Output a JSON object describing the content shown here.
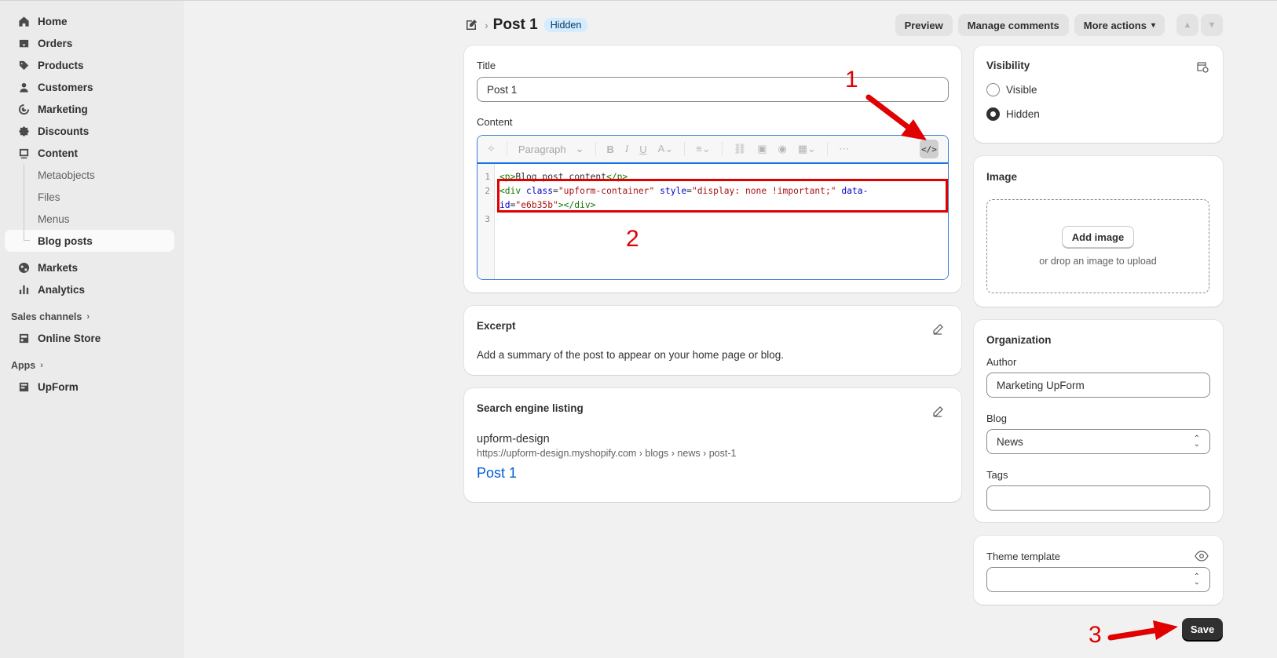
{
  "sidebar": {
    "items": [
      {
        "label": "Home",
        "icon": "home-icon"
      },
      {
        "label": "Orders",
        "icon": "orders-icon"
      },
      {
        "label": "Products",
        "icon": "tag-icon"
      },
      {
        "label": "Customers",
        "icon": "person-icon"
      },
      {
        "label": "Marketing",
        "icon": "target-icon"
      },
      {
        "label": "Discounts",
        "icon": "discount-icon"
      },
      {
        "label": "Content",
        "icon": "content-icon"
      }
    ],
    "content_subitems": [
      "Metaobjects",
      "Files",
      "Menus",
      "Blog posts"
    ],
    "active_subitem": "Blog posts",
    "items2": [
      {
        "label": "Markets",
        "icon": "globe-icon"
      },
      {
        "label": "Analytics",
        "icon": "bar-chart-icon"
      }
    ],
    "sales_channels_label": "Sales channels",
    "online_store_label": "Online Store",
    "apps_label": "Apps",
    "upform_label": "UpForm"
  },
  "header": {
    "title": "Post 1",
    "status_badge": "Hidden",
    "preview": "Preview",
    "manage_comments": "Manage comments",
    "more_actions": "More actions"
  },
  "main": {
    "title_label": "Title",
    "title_value": "Post 1",
    "content_label": "Content",
    "paragraph_select": "Paragraph",
    "code_lines": [
      "1",
      "2",
      "3"
    ],
    "code": {
      "line1_open": "<p>",
      "line1_text": "Blog post content",
      "line1_close": "</p>",
      "line2_tag_open": "<div",
      "line2_attr1": "class",
      "line2_val1": "\"upform-container\"",
      "line2_attr2": "style",
      "line2_val2": "\"display: none !important;\"",
      "line2_attr3a": "data-",
      "line2_attr3b": "id",
      "line2_val3": "\"e6b35b\"",
      "line2_tag_close": "></div>",
      "eq": "="
    },
    "excerpt_title": "Excerpt",
    "excerpt_text": "Add a summary of the post to appear on your home page or blog.",
    "seo_title": "Search engine listing",
    "seo_site": "upform-design",
    "seo_url": "https://upform-design.myshopify.com › blogs › news › post-1",
    "seo_link": "Post 1"
  },
  "right": {
    "visibility_title": "Visibility",
    "visible": "Visible",
    "hidden": "Hidden",
    "selected_visibility": "Hidden",
    "image_title": "Image",
    "add_image": "Add image",
    "drop_hint": "or drop an image to upload",
    "organization_title": "Organization",
    "author_label": "Author",
    "author_value": "Marketing UpForm",
    "blog_label": "Blog",
    "blog_value": "News",
    "tags_label": "Tags",
    "tags_value": "",
    "theme_template_label": "Theme template",
    "theme_template_value": ""
  },
  "save_button": "Save",
  "annotations": {
    "n1": "1",
    "n2": "2",
    "n3": "3",
    "color": "#e00000"
  },
  "colors": {
    "badge_bg": "#d5ebff",
    "link": "#005bd3",
    "save_bg": "#303030"
  }
}
